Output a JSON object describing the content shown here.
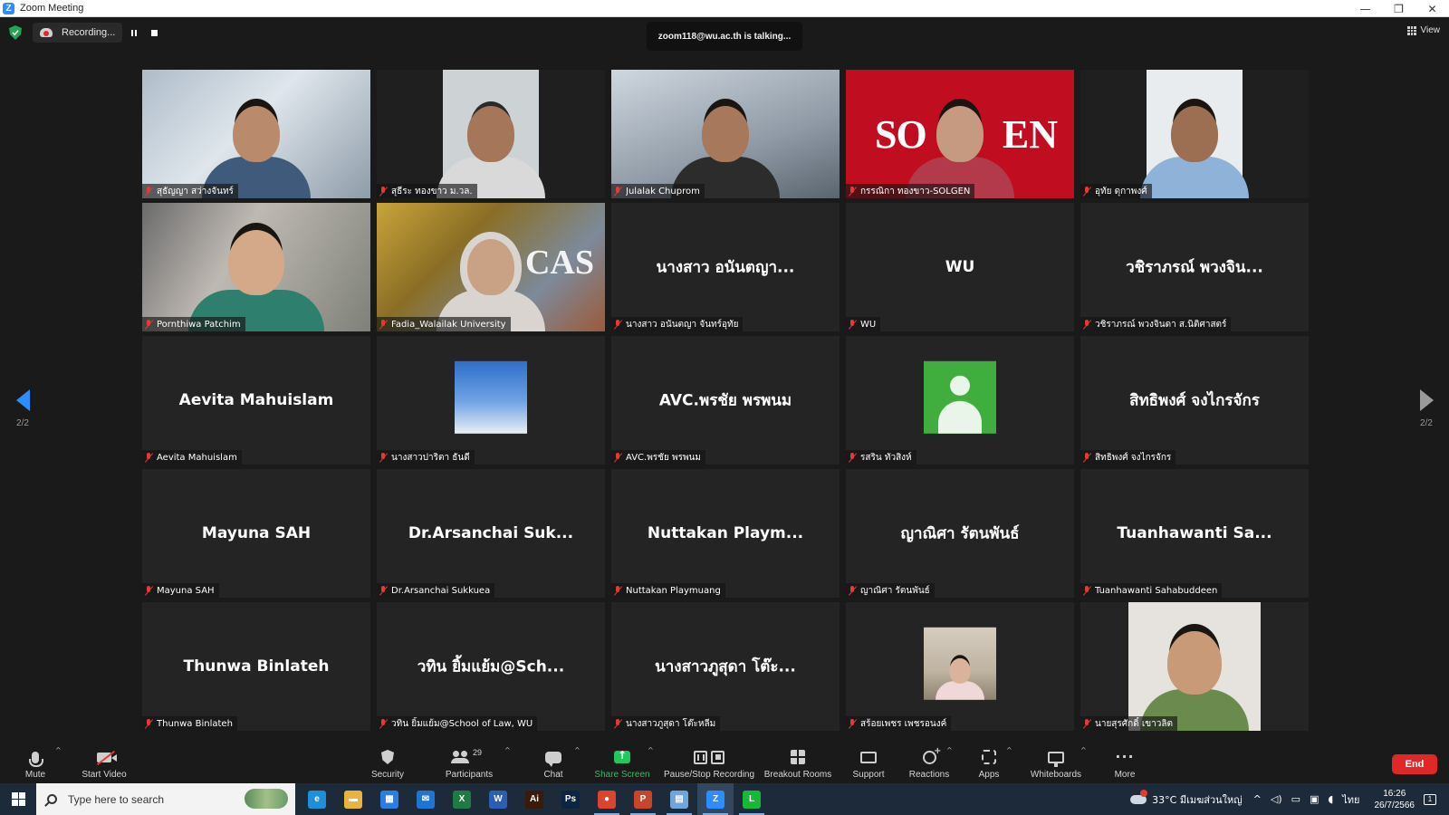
{
  "window": {
    "title": "Zoom Meeting",
    "minimize": "—",
    "restore": "❐",
    "close": "✕"
  },
  "topbar": {
    "recording_label": "Recording...",
    "talking": "zoom118@wu.ac.th is talking...",
    "view_label": "View"
  },
  "pager": {
    "left_page": "2/2",
    "right_page": "2/2"
  },
  "participants": [
    {
      "name": "สุธัญญา สว่างจันทร์",
      "display": ""
    },
    {
      "name": "สุธีระ ทองขาว ม.วล.",
      "display": ""
    },
    {
      "name": "Julalak Chuprom",
      "display": ""
    },
    {
      "name": "กรรณิกา ทองขาว-SOLGEN",
      "display": ""
    },
    {
      "name": "อุทัย ดุกาพงศ์",
      "display": ""
    },
    {
      "name": "Pornthiwa Patchim",
      "display": ""
    },
    {
      "name": "Fadia_Walailak University",
      "display": ""
    },
    {
      "name": "นางสาว อนันตญา จันทร์อุทัย",
      "display": "นางสาว อนันตญา..."
    },
    {
      "name": "WU",
      "display": "WU"
    },
    {
      "name": "วชิราภรณ์ พวงจินดา ส.นิติศาสตร์",
      "display": "วชิราภรณ์ พวงจิน..."
    },
    {
      "name": "Aevita Mahuislam",
      "display": "Aevita Mahuislam"
    },
    {
      "name": "นางสาวปาริตา ธันดี",
      "display": ""
    },
    {
      "name": "AVC.พรชัย พรพนม",
      "display": "AVC.พรชัย พรพนม"
    },
    {
      "name": "รสริน ทัวสิงห์",
      "display": ""
    },
    {
      "name": "สิทธิพงศ์ จงไกรจักร",
      "display": "สิทธิพงศ์ จงไกรจักร"
    },
    {
      "name": "Mayuna SAH",
      "display": "Mayuna SAH"
    },
    {
      "name": "Dr.Arsanchai Sukkuea",
      "display": "Dr.Arsanchai Suk..."
    },
    {
      "name": "Nuttakan Playmuang",
      "display": "Nuttakan Playm..."
    },
    {
      "name": "ญาณิศา รัตนพันธ์",
      "display": "ญาณิศา รัตนพันธ์"
    },
    {
      "name": "Tuanhawanti Sahabuddeen",
      "display": "Tuanhawanti Sa..."
    },
    {
      "name": "Thunwa Binlateh",
      "display": "Thunwa Binlateh"
    },
    {
      "name": "วทิน ยิ้มแย้ม@School of Law, WU",
      "display": "วทิน ยิ้มแย้ม@Sch..."
    },
    {
      "name": "นางสาวภูสุดา โต๊ะหลีม",
      "display": "นางสาวภูสุดา โต๊ะ..."
    },
    {
      "name": "สร้อยเพชร เพชรอนงค์",
      "display": ""
    },
    {
      "name": "นายสุรศักดิ์ เขาวลิต",
      "display": ""
    }
  ],
  "tile_art": {
    "solgen_left": "SO",
    "solgen_right": "EN",
    "cas_text": "CAS"
  },
  "controls": {
    "mute": "Mute",
    "start_video": "Start Video",
    "security": "Security",
    "participants": "Participants",
    "participants_count": "29",
    "chat": "Chat",
    "share_screen": "Share Screen",
    "pause_stop_recording": "Pause/Stop Recording",
    "breakout_rooms": "Breakout Rooms",
    "support": "Support",
    "reactions": "Reactions",
    "apps": "Apps",
    "whiteboards": "Whiteboards",
    "more": "More",
    "more_glyph": "···",
    "end": "End",
    "caret": "^"
  },
  "taskbar": {
    "search_placeholder": "Type here to search",
    "weather": "33°C มีเมฆส่วนใหญ่",
    "lang": "ไทย",
    "time": "16:26",
    "date": "26/7/2566",
    "notif_count": "1",
    "tray_up": "^",
    "apps": [
      {
        "name": "edge",
        "glyph": "e",
        "color": "#1f8fd6"
      },
      {
        "name": "file-explorer",
        "glyph": "▬",
        "color": "#e8b53a"
      },
      {
        "name": "store",
        "glyph": "▦",
        "color": "#2b7de0"
      },
      {
        "name": "mail",
        "glyph": "✉",
        "color": "#1e74d0"
      },
      {
        "name": "excel",
        "glyph": "X",
        "color": "#1f7a44"
      },
      {
        "name": "word",
        "glyph": "W",
        "color": "#2b5fb3"
      },
      {
        "name": "illustrator",
        "glyph": "Ai",
        "color": "#3a1a0a"
      },
      {
        "name": "photoshop",
        "glyph": "Ps",
        "color": "#0c2540"
      },
      {
        "name": "chrome",
        "glyph": "●",
        "color": "#d9452f"
      },
      {
        "name": "powerpoint",
        "glyph": "P",
        "color": "#c8442a"
      },
      {
        "name": "notepad",
        "glyph": "▤",
        "color": "#6fa5d8"
      },
      {
        "name": "zoom",
        "glyph": "Z",
        "color": "#2d8cff"
      },
      {
        "name": "line",
        "glyph": "L",
        "color": "#17b83a"
      }
    ]
  }
}
